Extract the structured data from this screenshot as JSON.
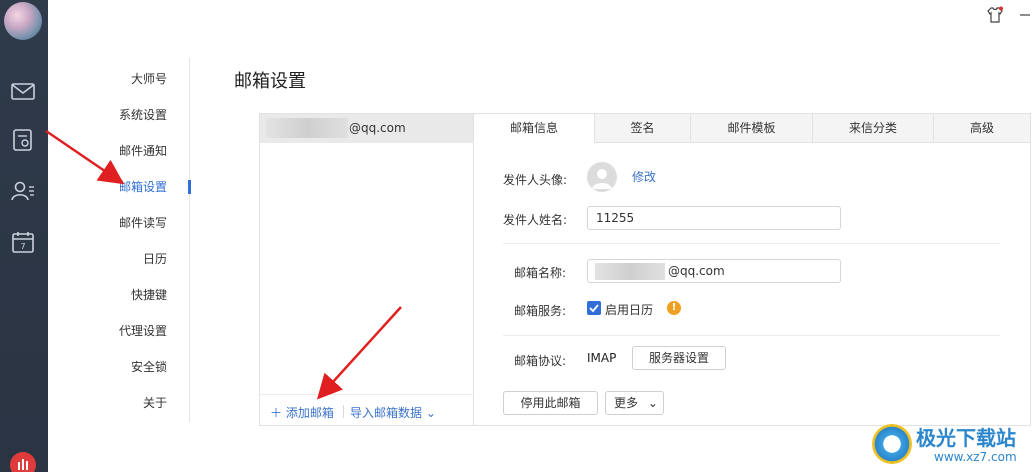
{
  "rail": {
    "icons": [
      "mail-icon",
      "contacts-card-icon",
      "address-book-icon",
      "calendar-icon"
    ],
    "calendar_day": "7"
  },
  "nav": {
    "items": [
      {
        "label": "大师号"
      },
      {
        "label": "系统设置"
      },
      {
        "label": "邮件通知"
      },
      {
        "label": "邮箱设置",
        "active": true
      },
      {
        "label": "邮件读写"
      },
      {
        "label": "日历"
      },
      {
        "label": "快捷键"
      },
      {
        "label": "代理设置"
      },
      {
        "label": "安全锁"
      },
      {
        "label": "关于"
      }
    ]
  },
  "page": {
    "title": "邮箱设置"
  },
  "account_list": {
    "selected_email": "@qq.com",
    "add_label": "添加邮箱",
    "import_label": "导入邮箱数据"
  },
  "tabs": [
    {
      "label": "邮箱信息",
      "active": true
    },
    {
      "label": "签名"
    },
    {
      "label": "邮件模板"
    },
    {
      "label": "来信分类"
    },
    {
      "label": "高级"
    }
  ],
  "form": {
    "sender_avatar_label": "发件人头像:",
    "edit_link": "修改",
    "sender_name_label": "发件人姓名:",
    "sender_name_value": "11255",
    "mailbox_name_label": "邮箱名称:",
    "mailbox_name_value": "@qq.com",
    "mailbox_service_label": "邮箱服务:",
    "enable_calendar_label": "启用日历",
    "enable_calendar_checked": true,
    "protocol_label": "邮箱协议:",
    "protocol_value": "IMAP",
    "server_settings_button": "服务器设置",
    "disable_mailbox_button": "停用此邮箱",
    "more_button": "更多"
  },
  "watermark": {
    "title": "极光下载站",
    "url": "www.xz7.com"
  },
  "colors": {
    "rail_bg": "#2f3a4a",
    "accent": "#2f6fd6",
    "link": "#3a72c9",
    "annotation_arrow": "#e02020",
    "warning": "#f0a020"
  }
}
